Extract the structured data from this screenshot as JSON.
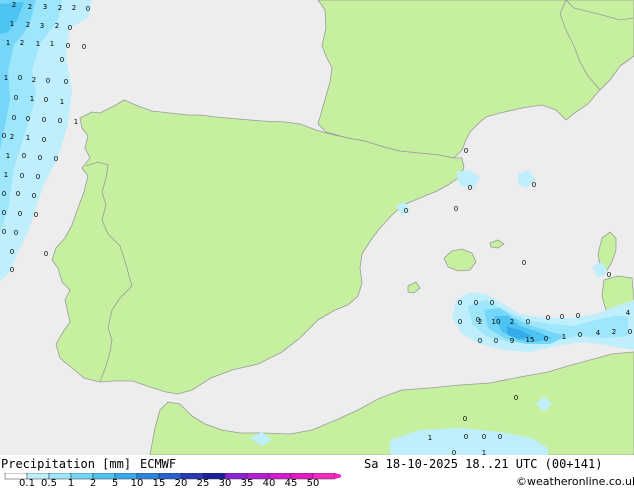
{
  "footer": {
    "title": "Precipitation [mm]",
    "model": "ECMWF",
    "valid_time": "Sa 18-10-2025 18..21 UTC (00+141)",
    "credit": "©weatheronline.co.uk"
  },
  "colorbar": {
    "ticks": [
      "0.1",
      "0.5",
      "1",
      "2",
      "5",
      "10",
      "15",
      "20",
      "25",
      "30",
      "35",
      "40",
      "45",
      "50"
    ],
    "colors": [
      "#ffffff",
      "#bfeefc",
      "#9de6fb",
      "#74d6f8",
      "#4dc3f1",
      "#37aaea",
      "#2d84dd",
      "#2a5fcf",
      "#2a38b7",
      "#1c1e99",
      "#8a22d4",
      "#b41fd4",
      "#d21cd0",
      "#e51ac4",
      "#f22ac0"
    ]
  },
  "colors": {
    "sea": "#ededed",
    "land": "#c6f0a0",
    "border": "#9a9a9a",
    "precip_light": "#bfeefc",
    "precip_mid": "#9de6fb",
    "precip_high": "#74d6f8",
    "precip_heavy": "#4dc3f1",
    "precip_core": "#37aaea"
  },
  "precip_labels": [
    "2",
    "2",
    "3",
    "2",
    "2",
    "0",
    "1",
    "2",
    "3",
    "2",
    "0",
    "1",
    "2",
    "1",
    "1",
    "0",
    "0",
    "0",
    "1",
    "0",
    "2",
    "0",
    "0",
    "0",
    "1",
    "0",
    "1",
    "0",
    "0",
    "0",
    "0",
    "1",
    "0",
    "2",
    "1",
    "0",
    "1",
    "0",
    "0",
    "0",
    "1",
    "0",
    "0",
    "0",
    "0",
    "0",
    "0",
    "0",
    "0",
    "0",
    "0",
    "0",
    "0",
    "0",
    "0",
    "0",
    "0",
    "0",
    "0",
    "0",
    "0",
    "0",
    "0",
    "0",
    "4",
    "0",
    "0",
    "0",
    "0",
    "2",
    "10",
    "2",
    "0",
    "0",
    "0",
    "0",
    "9",
    "15",
    "0",
    "1",
    "0",
    "4",
    "2",
    "0",
    "0",
    "0",
    "1",
    "0",
    "0",
    "0",
    "1",
    "0"
  ]
}
